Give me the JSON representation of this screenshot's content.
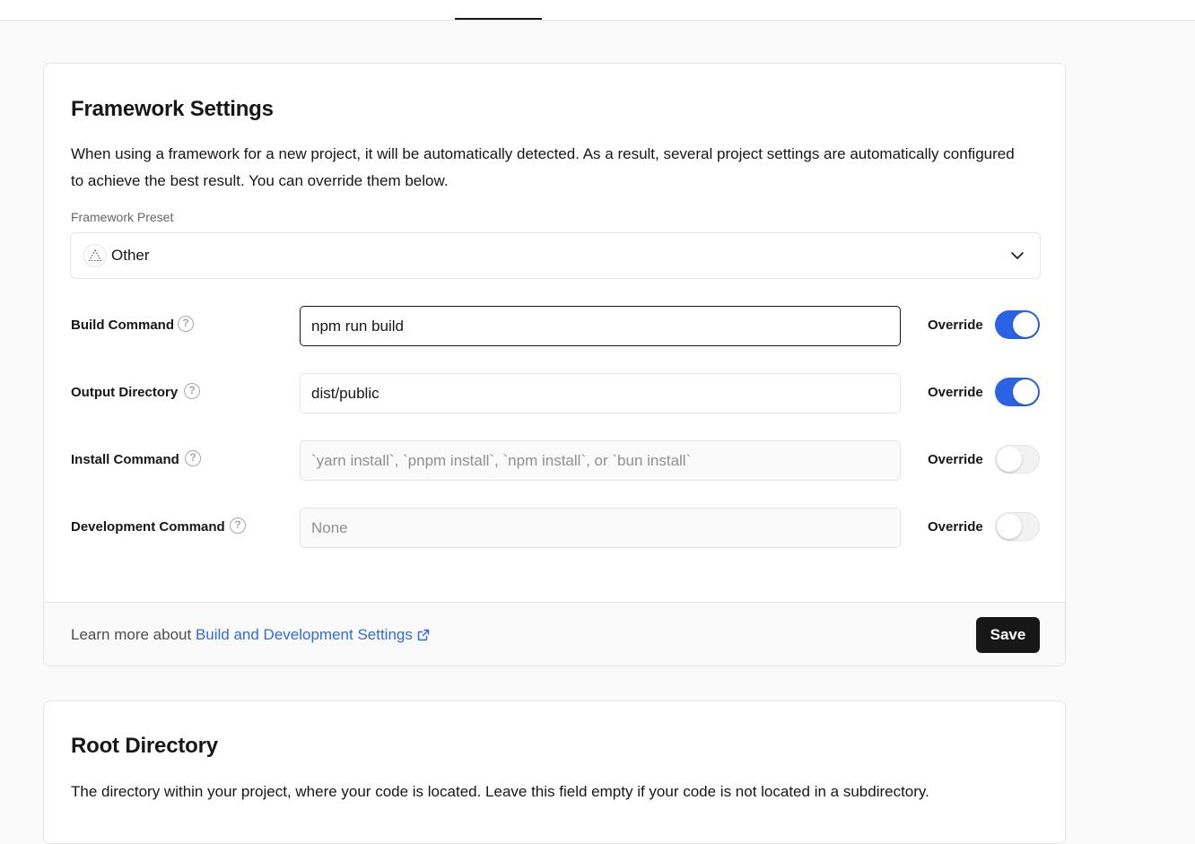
{
  "framework_settings": {
    "title": "Framework Settings",
    "description": "When using a framework for a new project, it will be automatically detected. As a result, several project settings are automatically configured to achieve the best result. You can override them below.",
    "preset_label": "Framework Preset",
    "preset_value": "Other",
    "rows": [
      {
        "label": "Build Command",
        "value": "npm run build",
        "placeholder": "",
        "override_label": "Override",
        "override": true
      },
      {
        "label": "Output Directory",
        "value": "dist/public",
        "placeholder": "",
        "override_label": "Override",
        "override": true
      },
      {
        "label": "Install Command",
        "value": "",
        "placeholder": "`yarn install`, `pnpm install`, `npm install`, or `bun install`",
        "override_label": "Override",
        "override": false
      },
      {
        "label": "Development Command",
        "value": "",
        "placeholder": "None",
        "override_label": "Override",
        "override": false
      }
    ],
    "footer": {
      "learn_prefix": "Learn more about",
      "learn_link": "Build and Development Settings",
      "save_label": "Save"
    }
  },
  "root_directory": {
    "title": "Root Directory",
    "description": "The directory within your project, where your code is located. Leave this field empty if your code is not located in a subdirectory."
  },
  "colors": {
    "toggle_on": "#2b63e6",
    "link": "#2f6bde",
    "save_button": "#171717"
  },
  "icons": {
    "framework": "triangle-dashed-icon",
    "chevron": "chevron-down-icon",
    "help": "question-circle-icon",
    "external_link": "external-link-icon"
  }
}
